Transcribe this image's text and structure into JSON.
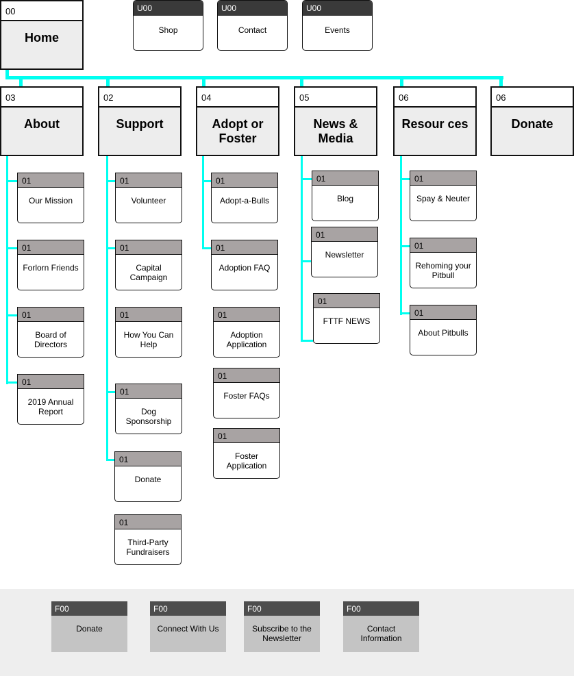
{
  "colors": {
    "connector": "#00fff0",
    "child_header": "#a8a3a3",
    "utility_header": "#3a3a3a",
    "footer_header": "#4d4d4d",
    "footer_body": "#c4c4c4",
    "footer_bg": "#eeeeee"
  },
  "home": {
    "code": "00",
    "title": "Home"
  },
  "utility": [
    {
      "code": "U00",
      "title": "Shop"
    },
    {
      "code": "U00",
      "title": "Contact"
    },
    {
      "code": "U00",
      "title": "Events"
    }
  ],
  "sections": [
    {
      "code": "03",
      "title": "About",
      "children": [
        {
          "code": "01",
          "title": "Our Mission"
        },
        {
          "code": "01",
          "title": "Forlorn Friends"
        },
        {
          "code": "01",
          "title": "Board of Directors"
        },
        {
          "code": "01",
          "title": "2019 Annual Report"
        }
      ]
    },
    {
      "code": "02",
      "title": "Support",
      "children": [
        {
          "code": "01",
          "title": "Volunteer"
        },
        {
          "code": "01",
          "title": "Capital Campaign"
        },
        {
          "code": "01",
          "title": "How You Can Help"
        },
        {
          "code": "01",
          "title": "Dog Sponsorship"
        },
        {
          "code": "01",
          "title": "Donate"
        },
        {
          "code": "01",
          "title": "Third-Party Fundraisers"
        }
      ]
    },
    {
      "code": "04",
      "title": "Adopt or Foster",
      "children": [
        {
          "code": "01",
          "title": "Adopt-a-Bulls"
        },
        {
          "code": "01",
          "title": "Adoption FAQ"
        },
        {
          "code": "01",
          "title": "Adoption Application"
        },
        {
          "code": "01",
          "title": "Foster FAQs"
        },
        {
          "code": "01",
          "title": "Foster Application"
        }
      ]
    },
    {
      "code": "05",
      "title": "News & Media",
      "children": [
        {
          "code": "01",
          "title": "Blog"
        },
        {
          "code": "01",
          "title": "Newsletter"
        },
        {
          "code": "01",
          "title": "FTTF NEWS"
        }
      ]
    },
    {
      "code": "06",
      "title": "Resour ces",
      "children": [
        {
          "code": "01",
          "title": "Spay & Neuter"
        },
        {
          "code": "01",
          "title": "Rehoming your Pitbull"
        },
        {
          "code": "01",
          "title": "About Pitbulls"
        }
      ]
    },
    {
      "code": "06",
      "title": "Donate",
      "children": []
    }
  ],
  "footer": [
    {
      "code": "F00",
      "title": "Donate"
    },
    {
      "code": "F00",
      "title": "Connect With Us"
    },
    {
      "code": "F00",
      "title": "Subscribe to the Newsletter"
    },
    {
      "code": "F00",
      "title": "Contact Information"
    }
  ]
}
